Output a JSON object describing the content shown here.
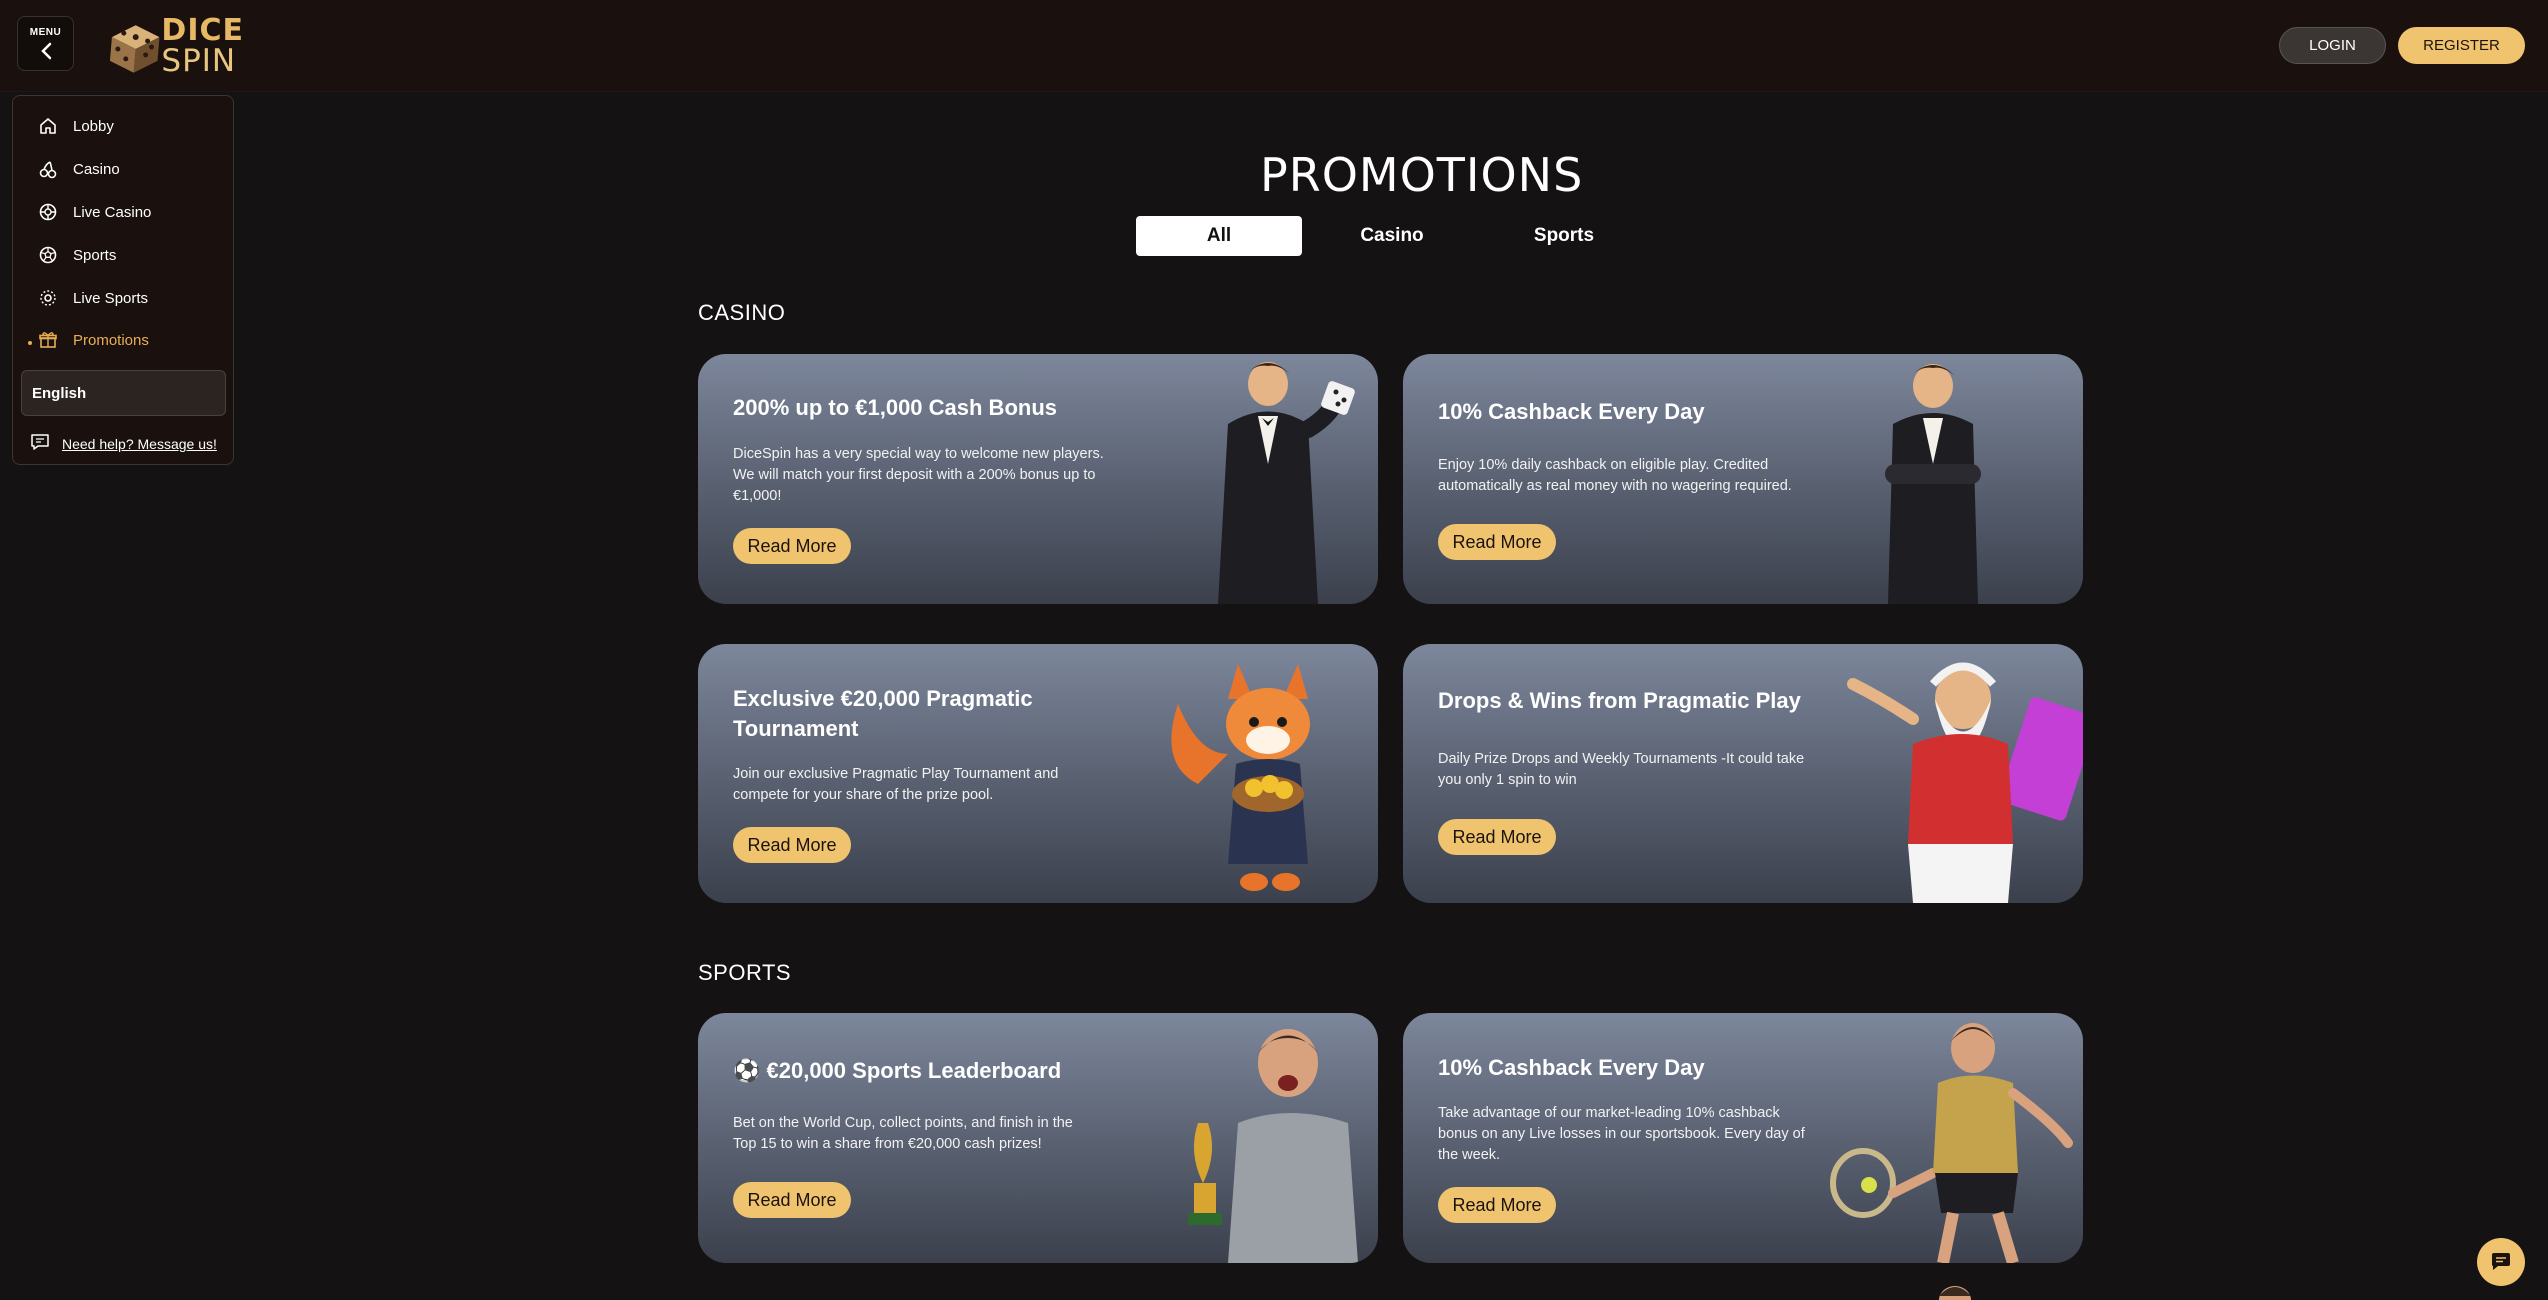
{
  "header": {
    "menu_label": "MENU",
    "logo_top": "DICE",
    "logo_bottom": "SPIN",
    "login_label": "LOGIN",
    "register_label": "REGISTER"
  },
  "sidebar": {
    "items": [
      {
        "label": "Lobby",
        "icon": "home-icon"
      },
      {
        "label": "Casino",
        "icon": "cherries-icon"
      },
      {
        "label": "Live Casino",
        "icon": "roulette-icon"
      },
      {
        "label": "Sports",
        "icon": "soccer-ball-icon"
      },
      {
        "label": "Live Sports",
        "icon": "live-signal-icon"
      },
      {
        "label": "Promotions",
        "icon": "gift-icon",
        "active": true
      }
    ],
    "language": "English",
    "help_label": "Need help? Message us!"
  },
  "main": {
    "title": "PROMOTIONS",
    "tabs": [
      {
        "label": "All",
        "active": true
      },
      {
        "label": "Casino"
      },
      {
        "label": "Sports"
      }
    ],
    "sections": [
      {
        "title": "CASINO",
        "cards": [
          {
            "title": "200% up to €1,000 Cash Bonus",
            "desc": "DiceSpin has a very special way to welcome new players. We will match your first deposit with a 200% bonus up to €1,000!",
            "button": "Read More"
          },
          {
            "title": "10% Cashback Every Day",
            "desc": "Enjoy 10% daily cashback on eligible play. Credited automatically as real money with no wagering required.",
            "button": "Read More"
          },
          {
            "title": "Exclusive €20,000 Pragmatic Tournament",
            "desc": "Join our exclusive Pragmatic Play Tournament and compete for your share of the prize pool.",
            "button": "Read More"
          },
          {
            "title": "Drops & Wins from Pragmatic Play",
            "desc": "Daily Prize Drops and Weekly Tournaments -It could take you only 1 spin to win",
            "button": "Read More"
          }
        ]
      },
      {
        "title": "SPORTS",
        "cards": [
          {
            "title": "⚽ €20,000 Sports Leaderboard",
            "desc": "Bet on the World Cup, collect points, and finish in the Top 15 to win a share from €20,000 cash prizes!",
            "button": "Read More"
          },
          {
            "title": "10% Cashback Every Day",
            "desc": "Take advantage of our market-leading 10% cashback bonus on any Live losses in our sportsbook. Every day of the week.",
            "button": "Read More"
          }
        ]
      }
    ]
  },
  "colors": {
    "accent": "#f0c36e",
    "background": "#141212",
    "header": "#1a100d",
    "active_nav": "#e7ae55"
  }
}
